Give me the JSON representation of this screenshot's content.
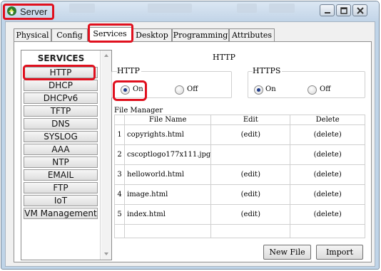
{
  "window": {
    "title": "Server"
  },
  "tabs": [
    {
      "label": "Physical"
    },
    {
      "label": "Config"
    },
    {
      "label": "Services"
    },
    {
      "label": "Desktop"
    },
    {
      "label": "Programming"
    },
    {
      "label": "Attributes"
    }
  ],
  "services": {
    "heading": "SERVICES",
    "items": [
      {
        "label": "HTTP"
      },
      {
        "label": "DHCP"
      },
      {
        "label": "DHCPv6"
      },
      {
        "label": "TFTP"
      },
      {
        "label": "DNS"
      },
      {
        "label": "SYSLOG"
      },
      {
        "label": "AAA"
      },
      {
        "label": "NTP"
      },
      {
        "label": "EMAIL"
      },
      {
        "label": "FTP"
      },
      {
        "label": "IoT"
      },
      {
        "label": "VM Management"
      }
    ]
  },
  "main": {
    "title": "HTTP",
    "http": {
      "label": "HTTP",
      "on": "On",
      "off": "Off",
      "selected": "On"
    },
    "https": {
      "label": "HTTPS",
      "on": "On",
      "off": "Off",
      "selected": "On"
    },
    "file_manager": {
      "label": "File Manager",
      "columns": [
        "File Name",
        "Edit",
        "Delete"
      ],
      "rows": [
        {
          "index": "1",
          "name": "copyrights.html",
          "edit": "(edit)",
          "delete": "(delete)"
        },
        {
          "index": "2",
          "name": "cscoptlogo177x111.jpg",
          "edit": "",
          "delete": "(delete)"
        },
        {
          "index": "3",
          "name": "helloworld.html",
          "edit": "(edit)",
          "delete": "(delete)"
        },
        {
          "index": "4",
          "name": "image.html",
          "edit": "(edit)",
          "delete": "(delete)"
        },
        {
          "index": "5",
          "name": "index.html",
          "edit": "(edit)",
          "delete": "(delete)"
        }
      ]
    },
    "buttons": {
      "new_file": "New File",
      "import": "Import"
    }
  },
  "colors": {
    "highlight": "#e0101e",
    "radio_selected": "#1f3c8a"
  }
}
